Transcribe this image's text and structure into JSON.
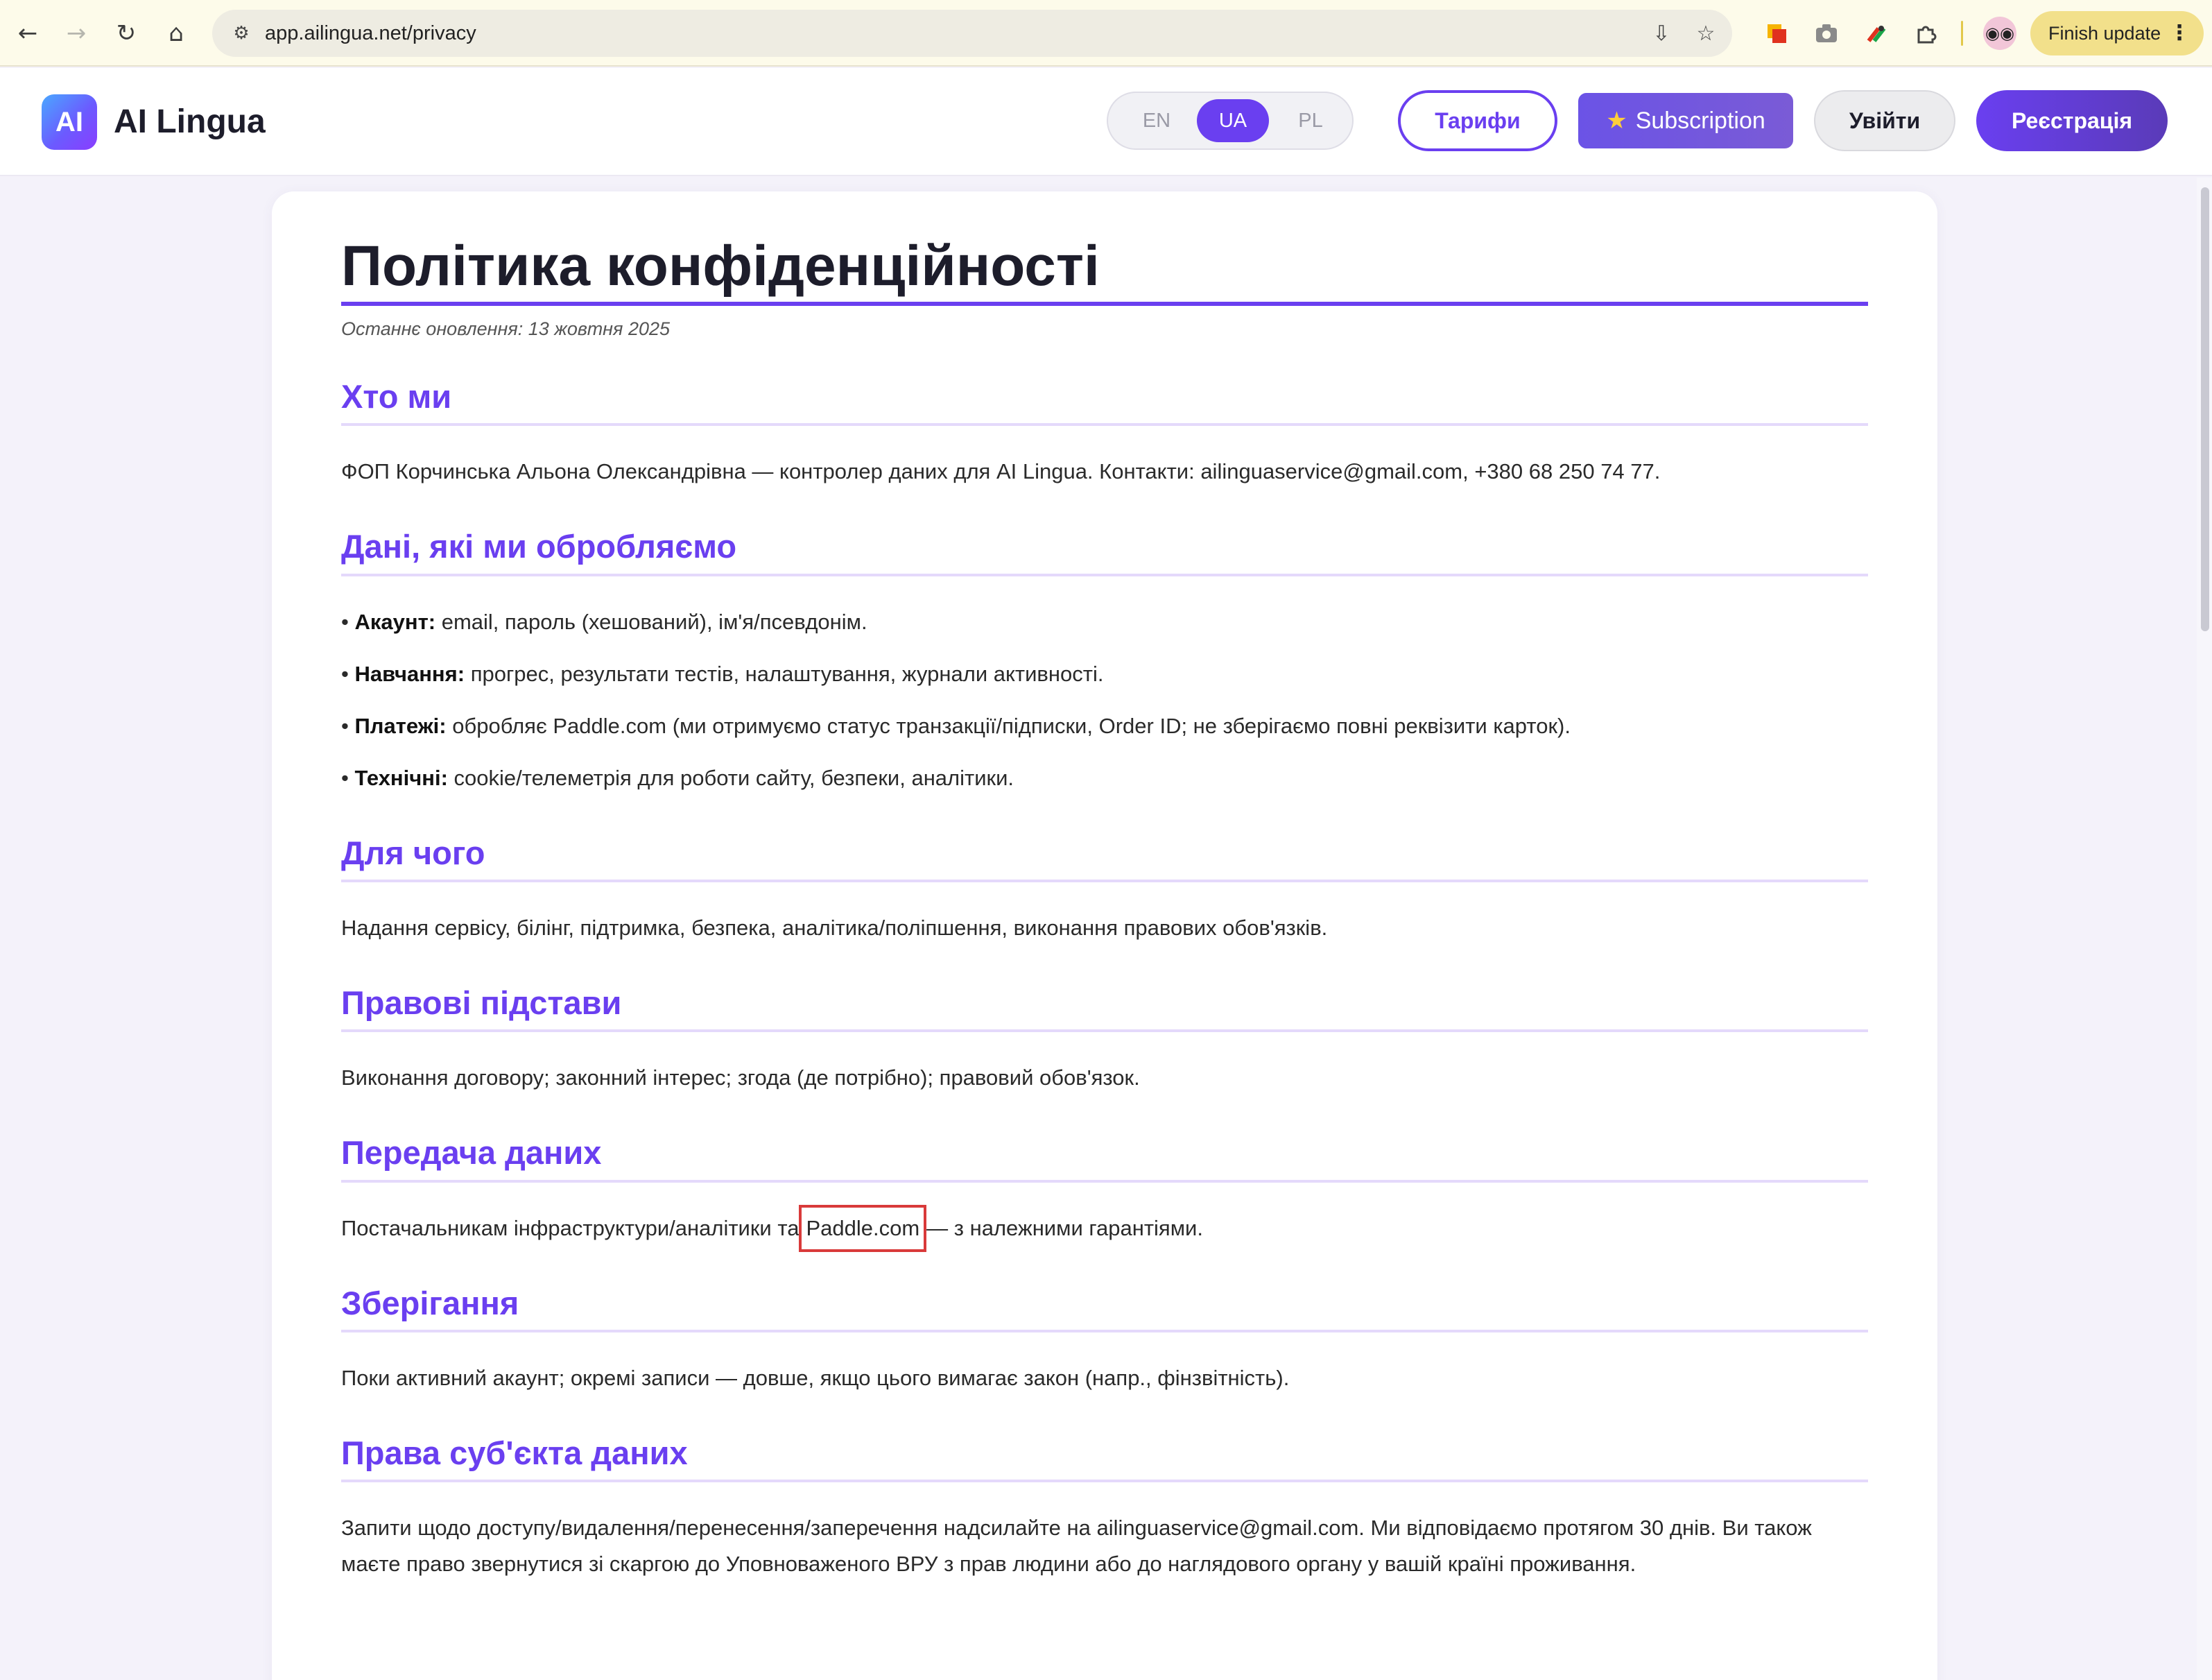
{
  "browser": {
    "url": "app.ailingua.net/privacy",
    "finish_update_label": "Finish update",
    "icons": {
      "back": "back-arrow-icon",
      "forward": "forward-arrow-icon",
      "reload": "reload-icon",
      "home": "home-icon",
      "site_settings": "site-settings-icon",
      "install": "install-app-icon",
      "bookmark": "star-icon",
      "menu": "kebab-menu-icon"
    }
  },
  "header": {
    "logo_mark": "AI",
    "logo_text": "AI Lingua",
    "languages": [
      {
        "label": "EN",
        "active": false
      },
      {
        "label": "UA",
        "active": true
      },
      {
        "label": "PL",
        "active": false
      }
    ],
    "tariffs_label": "Тарифи",
    "subscription_label": "Subscription",
    "login_label": "Увійти",
    "register_label": "Реєстрація",
    "colors": {
      "accent": "#6a3ff0",
      "highlight_box": "#d93a3a"
    }
  },
  "page": {
    "title": "Політика конфіденційності",
    "last_updated": "Останнє оновлення: 13 жовтня 2025",
    "sections": {
      "who": {
        "heading": "Хто ми",
        "text": "ФОП Корчинська Альона Олександрівна — контролер даних для AI Lingua. Контакти: ailinguaservice@gmail.com, +380 68 250 74 77."
      },
      "data": {
        "heading": "Дані, які ми обробляємо",
        "items": [
          {
            "label": "Акаунт:",
            "text": " email, пароль (хешований), ім'я/псевдонім."
          },
          {
            "label": "Навчання:",
            "text": " прогрес, результати тестів, налаштування, журнали активності."
          },
          {
            "label": "Платежі:",
            "text": " обробляє Paddle.com (ми отримуємо статус транзакції/підписки, Order ID; не зберігаємо повні реквізити карток)."
          },
          {
            "label": "Технічні:",
            "text": " cookie/телеметрія для роботи сайту, безпеки, аналітики."
          }
        ]
      },
      "purpose": {
        "heading": "Для чого",
        "text": "Надання сервісу, білінг, підтримка, безпека, аналітика/поліпшення, виконання правових обов'язків."
      },
      "legal": {
        "heading": "Правові підстави",
        "text": "Виконання договору; законний інтерес; згода (де потрібно); правовий обов'язок."
      },
      "transfer": {
        "heading": "Передача даних",
        "text_before": "Постачальникам інфраструктури/аналітики та",
        "highlight": "Paddle.com",
        "text_after": "— з належними гарантіями."
      },
      "storage": {
        "heading": "Зберігання",
        "text": "Поки активний акаунт; окремі записи — довше, якщо цього вимагає закон (напр., фінзвітність)."
      },
      "rights": {
        "heading": "Права суб'єкта даних",
        "text": "Запити щодо доступу/видалення/перенесення/заперечення надсилайте на ailinguaservice@gmail.com. Ми відповідаємо протягом 30 днів. Ви також маєте право звернутися зі скаргою до Уповноваженого ВРУ з прав людини або до наглядового органу у вашій країні проживання."
      }
    }
  }
}
